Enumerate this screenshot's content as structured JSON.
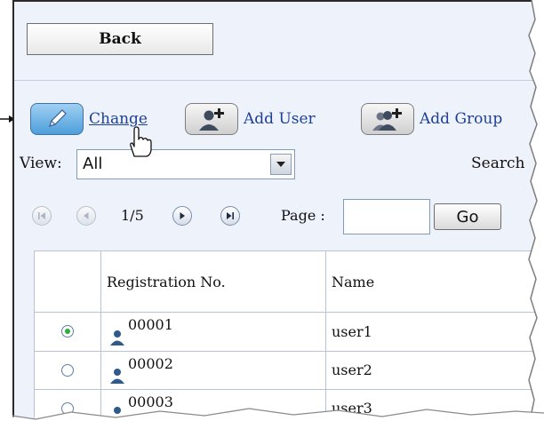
{
  "toolbar": {
    "back_label": "Back",
    "change_label": "Change",
    "add_user_label": "Add User",
    "add_group_label": "Add Group"
  },
  "view": {
    "label": "View:",
    "selected": "All",
    "search_label": "Search"
  },
  "pager": {
    "page_count": "1/5",
    "page_label": "Page :",
    "page_input_value": "",
    "go_label": "Go"
  },
  "table": {
    "columns": [
      "",
      "Registration No.",
      "Name"
    ],
    "rows": [
      {
        "selected": true,
        "reg_no": "00001",
        "name": "user1"
      },
      {
        "selected": false,
        "reg_no": "00002",
        "name": "user2"
      },
      {
        "selected": false,
        "reg_no": "00003",
        "name": "user3"
      }
    ]
  },
  "colors": {
    "panel_bg": "#eef3fb",
    "link": "#1d3f9a",
    "radio_selected": "#2fae3a"
  },
  "icons": {
    "change": "pencil-icon",
    "add_user": "add-user-icon",
    "add_group": "add-group-icon"
  }
}
